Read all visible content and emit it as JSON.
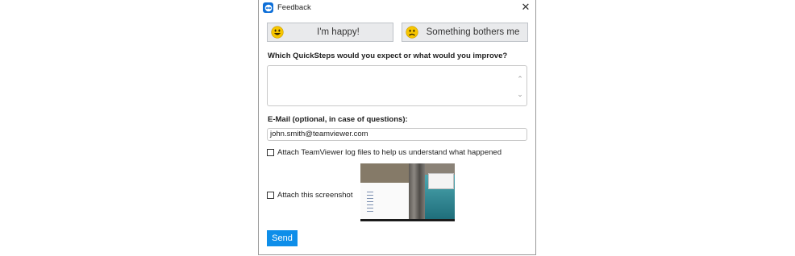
{
  "window": {
    "title": "Feedback"
  },
  "buttons": {
    "happy_label": "I'm happy!",
    "sad_label": "Something bothers me",
    "send_label": "Send",
    "close_glyph": "✕"
  },
  "improve": {
    "question": "Which QuickSteps would you expect or what would you improve?",
    "value": ""
  },
  "email": {
    "label": "E-Mail (optional, in case of questions):",
    "value": "john.smith@teamviewer.com"
  },
  "attach_log": {
    "label": "Attach TeamViewer log files to help us understand what happened",
    "checked": false
  },
  "attach_screenshot": {
    "label": "Attach this screenshot",
    "checked": false
  },
  "colors": {
    "accent": "#0e8ee9",
    "brand": "#0e6fd8",
    "emoji": "#f7c600"
  },
  "icons": [
    "teamviewer-logo-icon",
    "close-icon",
    "happy-face-icon",
    "sad-face-icon",
    "scroll-up-icon",
    "scroll-down-icon"
  ]
}
